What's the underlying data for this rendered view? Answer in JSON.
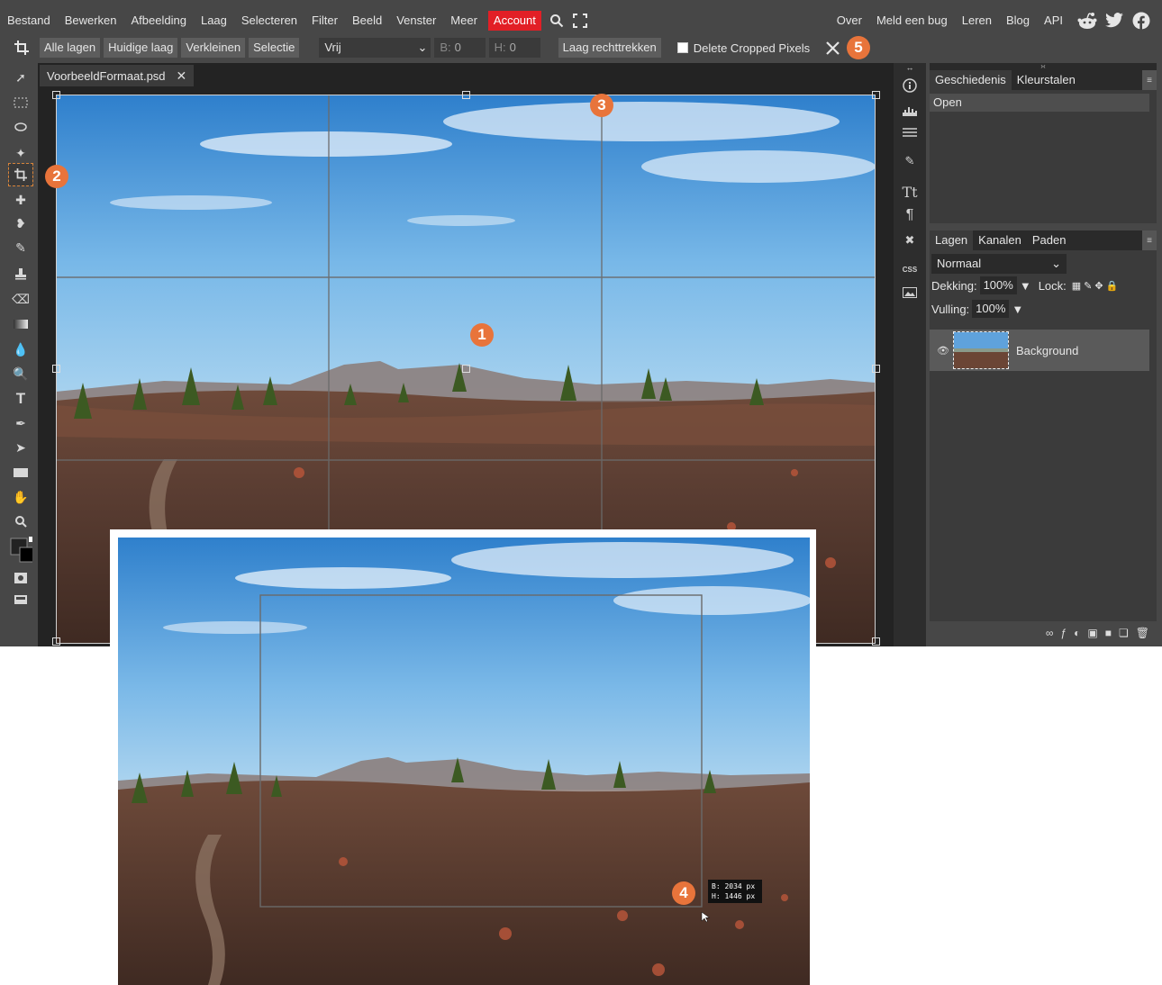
{
  "menu": {
    "items": [
      "Bestand",
      "Bewerken",
      "Afbeelding",
      "Laag",
      "Selecteren",
      "Filter",
      "Beeld",
      "Venster",
      "Meer"
    ],
    "account": "Account",
    "right_items": [
      "Over",
      "Meld een bug",
      "Leren",
      "Blog",
      "API"
    ],
    "icons": [
      "search-icon",
      "fullscreen-icon"
    ],
    "social_icons": [
      "reddit-icon",
      "twitter-icon",
      "facebook-icon"
    ]
  },
  "options": {
    "buttons": [
      "Alle lagen",
      "Huidige laag",
      "Verkleinen",
      "Selectie"
    ],
    "mode_select": "Vrij",
    "width_label": "B:",
    "width_value": "0",
    "height_label": "H:",
    "height_value": "0",
    "straighten": "Laag rechttrekken",
    "delete_cropped": "Delete Cropped Pixels"
  },
  "document": {
    "tab_title": "VoorbeeldFormaat.psd"
  },
  "panels": {
    "history_tabs": [
      "Geschiedenis",
      "Kleurstalen"
    ],
    "history_rows": [
      "Open"
    ],
    "layer_tabs": [
      "Lagen",
      "Kanalen",
      "Paden"
    ],
    "blend_mode": "Normaal",
    "opacity_label": "Dekking:",
    "opacity_value": "100%",
    "lock_label": "Lock:",
    "fill_label": "Vulling:",
    "fill_value": "100%",
    "layer_name": "Background",
    "css_label": "CSS"
  },
  "tooltip": {
    "width": "B: 2034 px",
    "height": "H: 1446 px"
  },
  "callouts": [
    "1",
    "2",
    "3",
    "4",
    "5"
  ],
  "colors": {
    "accent_orange": "#e8743b",
    "account_red": "#e21f26",
    "ui_dark": "#474747",
    "canvas_bg": "#232323"
  }
}
